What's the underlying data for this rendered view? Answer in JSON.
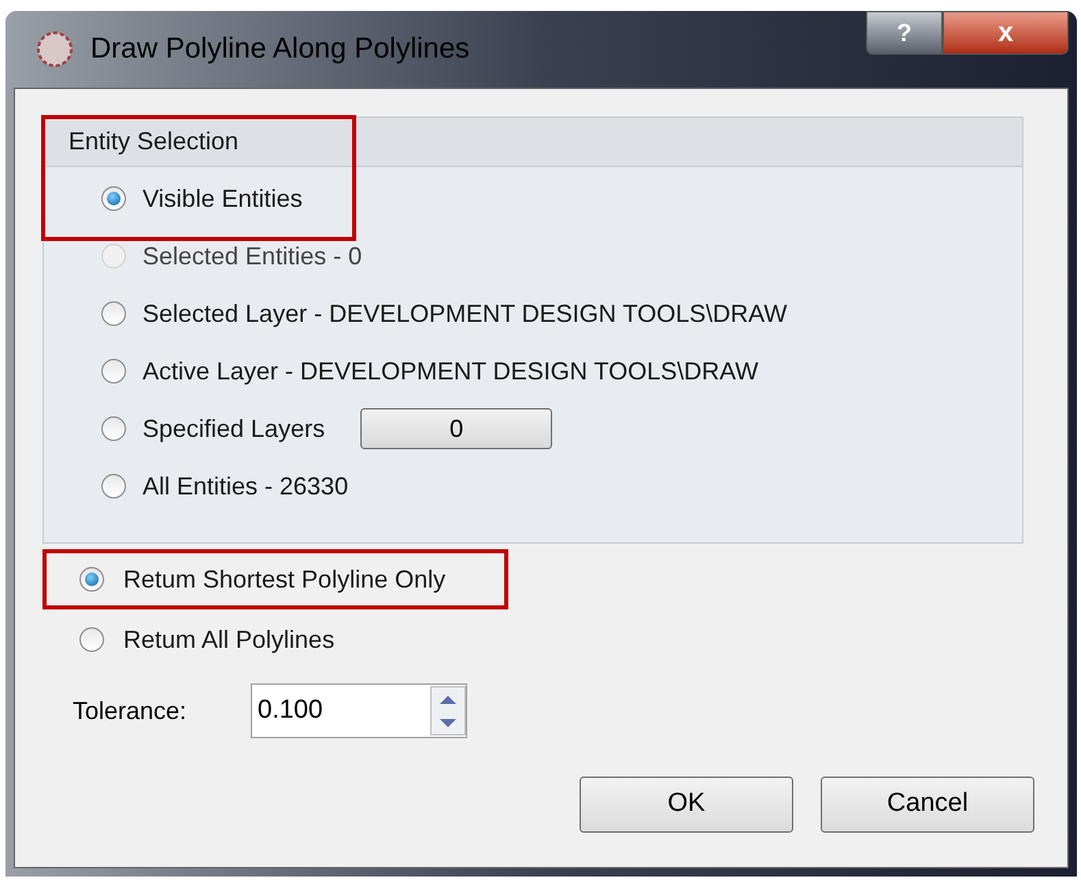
{
  "window": {
    "title": "Draw Polyline Along Polylines",
    "help_button": "?",
    "close_button": "x"
  },
  "entity_selection": {
    "title": "Entity Selection",
    "highlighted": true,
    "options": [
      {
        "label": "Visible Entities",
        "selected": true,
        "disabled": false,
        "kind": "radio"
      },
      {
        "label": "Selected Entities - 0",
        "selected": false,
        "disabled": true,
        "kind": "radio"
      },
      {
        "label": "Selected Layer - DEVELOPMENT DESIGN TOOLS\\DRAW",
        "selected": false,
        "disabled": false,
        "kind": "radio"
      },
      {
        "label": "Active Layer - DEVELOPMENT DESIGN TOOLS\\DRAW",
        "selected": false,
        "disabled": false,
        "kind": "radio"
      },
      {
        "label": "Specified Layers",
        "selected": false,
        "disabled": false,
        "kind": "radio-button",
        "button": "0"
      },
      {
        "label": "All Entities - 26330",
        "selected": false,
        "disabled": false,
        "kind": "radio"
      }
    ]
  },
  "return_options": [
    {
      "label": "Retum Shortest Polyline Only",
      "selected": true,
      "highlighted": true
    },
    {
      "label": "Retum All Polylines",
      "selected": false,
      "highlighted": false
    }
  ],
  "tolerance": {
    "label": "Tolerance:",
    "value": "0.100"
  },
  "buttons": [
    "OK",
    "Cancel"
  ]
}
